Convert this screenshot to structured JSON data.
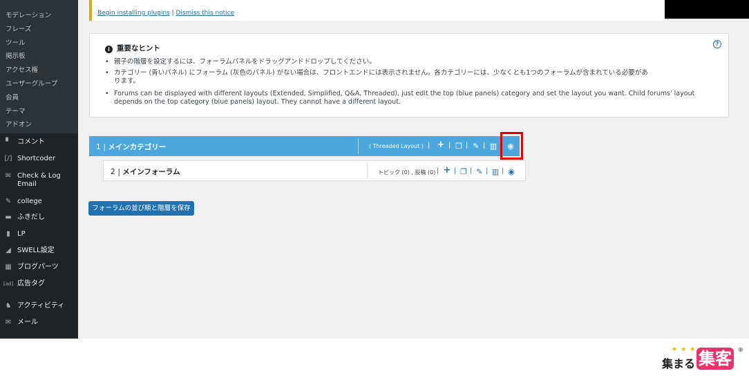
{
  "sidebar": {
    "submenu": [
      "モデレーション",
      "フレーズ",
      "ツール",
      "掲示板",
      "アクセス権",
      "ユーザーグループ",
      "会員",
      "テーマ",
      "アドオン"
    ],
    "menu": [
      {
        "label": "コメント",
        "icon": "comment-icon"
      },
      {
        "label": "Shortcoder",
        "icon": "shortcode-icon"
      },
      {
        "label": "Check & Log",
        "label2": "Email",
        "icon": "email-icon"
      },
      {
        "label": "college",
        "icon": "pin-icon"
      },
      {
        "label": "ふきだし",
        "icon": "balloon-icon"
      },
      {
        "label": "LP",
        "icon": "page-icon"
      },
      {
        "label": "SWELL設定",
        "icon": "bird-icon"
      },
      {
        "label": "ブログパーツ",
        "icon": "blog-parts-icon"
      },
      {
        "label": "広告タグ",
        "icon": "ad-icon"
      },
      {
        "label": "アクティビティ",
        "icon": "activity-icon"
      },
      {
        "label": "メール",
        "icon": "mail-icon"
      }
    ]
  },
  "notice": {
    "install_link": "Begin installing plugins",
    "separator": "|",
    "dismiss_link": "Dismiss this notice"
  },
  "hints": {
    "title": "重要なヒント",
    "help_icon": "?",
    "lines": [
      "親子の階層を設定するには、フォーラムパネルをドラッグアンドドロップしてください。",
      "カテゴリー (青いパネル) にフォーラム (灰色のパネル) がない場合は、フロントエンドには表示されません。各カテゴリーには、少なくとも1つのフォーラムが含まれている必要があ",
      "ります。",
      "Forums can be displayed with different layouts (Extended, Simplified, Q&A, Threaded), just edit the top (blue panels) category and set the layout you want. Child forums' layout",
      "depends on the top category (blue panels) layout. They cannot have a different layout."
    ]
  },
  "category": {
    "number": "1",
    "name": "メインカテゴリー",
    "layout": "( Threaded Layout )"
  },
  "forum": {
    "number": "2",
    "name": "メインフォーラム",
    "stats": "トピック (0) , 投稿 (0)"
  },
  "save_button": "フォーラムの並び順と階層を保存",
  "logo": {
    "stars": "★★★",
    "text1": "集まる",
    "text2": "集客",
    "reg": "®"
  },
  "colors": {
    "category_bg": "#4ba7dd",
    "primary": "#2271b1",
    "highlight": "#e00000",
    "sidebar": "#1d2327"
  }
}
